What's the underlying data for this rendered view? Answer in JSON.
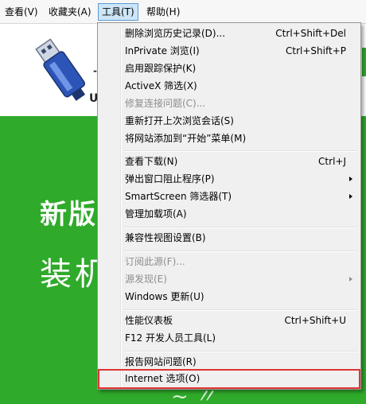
{
  "menubar": {
    "items": [
      {
        "label": "查看(V)"
      },
      {
        "label": "收藏夹(A)"
      },
      {
        "label": "工具(T)"
      },
      {
        "label": "帮助(H)"
      }
    ]
  },
  "page": {
    "hero_line1": "新版",
    "hero_line2": "装机",
    "logo_letter": "U"
  },
  "tools_menu": {
    "items": [
      {
        "label": "删除浏览历史记录(D)...",
        "shortcut": "Ctrl+Shift+Del"
      },
      {
        "label": "InPrivate 浏览(I)",
        "shortcut": "Ctrl+Shift+P"
      },
      {
        "label": "启用跟踪保护(K)",
        "shortcut": ""
      },
      {
        "label": "ActiveX 筛选(X)",
        "shortcut": ""
      },
      {
        "label": "修复连接问题(C)...",
        "shortcut": "",
        "disabled": true
      },
      {
        "label": "重新打开上次浏览会话(S)",
        "shortcut": ""
      },
      {
        "label": "将网站添加到“开始”菜单(M)",
        "shortcut": ""
      },
      {
        "label": "查看下载(N)",
        "shortcut": "Ctrl+J"
      },
      {
        "label": "弹出窗口阻止程序(P)",
        "shortcut": "",
        "submenu": true
      },
      {
        "label": "SmartScreen 筛选器(T)",
        "shortcut": "",
        "submenu": true
      },
      {
        "label": "管理加载项(A)",
        "shortcut": ""
      },
      {
        "label": "兼容性视图设置(B)",
        "shortcut": ""
      },
      {
        "label": "订阅此源(F)...",
        "shortcut": "",
        "disabled": true
      },
      {
        "label": "源发现(E)",
        "shortcut": "",
        "disabled": true,
        "submenu": true
      },
      {
        "label": "Windows 更新(U)",
        "shortcut": ""
      },
      {
        "label": "性能仪表板",
        "shortcut": "Ctrl+Shift+U"
      },
      {
        "label": "F12 开发人员工具(L)",
        "shortcut": ""
      },
      {
        "label": "报告网站问题(R)",
        "shortcut": ""
      },
      {
        "label": "Internet 选项(O)",
        "shortcut": "",
        "highlighted": true
      }
    ]
  },
  "colors": {
    "hero_green": "#2faa2a",
    "highlight_border": "#e03434",
    "menu_bg": "#f0f0f0",
    "disabled_text": "#8d8d8d"
  }
}
